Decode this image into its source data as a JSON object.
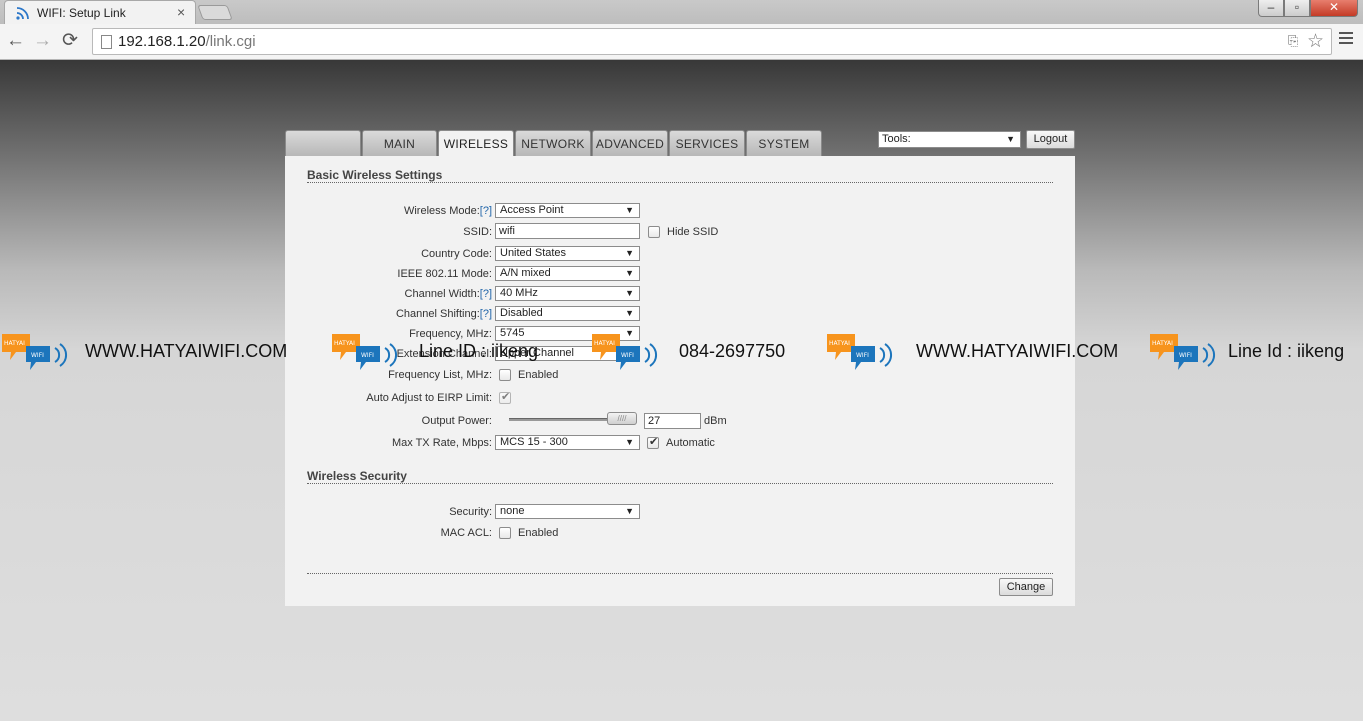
{
  "browser": {
    "tab_title": "WIFI: Setup Link",
    "tab_close": "×",
    "url_host": "192.168.1.20",
    "url_path": "/link.cgi",
    "back": "←",
    "forward": "→",
    "reload": "⟳",
    "star": "☆",
    "translate": "⎘",
    "win_min": "–",
    "win_max": "▫",
    "win_close": "✕"
  },
  "nav": {
    "logo_tab": "",
    "tabs": [
      "MAIN",
      "WIRELESS",
      "NETWORK",
      "ADVANCED",
      "SERVICES",
      "SYSTEM"
    ],
    "active_tab": "WIRELESS",
    "tools_select": "Tools:",
    "logout": "Logout"
  },
  "basic": {
    "title": "Basic Wireless Settings",
    "wireless_mode_label": "Wireless Mode:",
    "help": "[?]",
    "wireless_mode": "Access Point",
    "ssid_label": "SSID:",
    "ssid": "wifi",
    "hide_ssid": "Hide SSID",
    "country_code_label": "Country Code:",
    "country_code": "United States",
    "ieee_mode_label": "IEEE 802.11 Mode:",
    "ieee_mode": "A/N mixed",
    "channel_width_label": "Channel Width:",
    "channel_width": "40 MHz",
    "channel_shifting_label": "Channel Shifting:",
    "channel_shifting": "Disabled",
    "frequency_label": "Frequency, MHz:",
    "frequency": "5745",
    "extension_channel_label": "Extension Channel:",
    "extension_channel": "Upper Channel",
    "frequency_list_label": "Frequency List, MHz:",
    "frequency_list_enabled": "Enabled",
    "auto_eirp_label": "Auto Adjust to EIRP Limit:",
    "output_power_label": "Output Power:",
    "output_power": "27",
    "output_power_unit": "dBm",
    "slider_grip": "////",
    "max_tx_label": "Max TX Rate, Mbps:",
    "max_tx": "MCS 15 - 300",
    "automatic": "Automatic"
  },
  "security": {
    "title": "Wireless Security",
    "security_label": "Security:",
    "security": "none",
    "mac_acl_label": "MAC ACL:",
    "mac_acl_enabled": "Enabled"
  },
  "change_button": "Change",
  "dropdown_arrow": "▼",
  "watermark": {
    "site": "WWW.HATYAIWIFI.COM",
    "line_id_1": "Line ID : iikeng",
    "phone": "084-2697750",
    "line_id_2": "Line Id : iikeng",
    "logo_top": "HATYAI",
    "logo_bottom": "WIFI",
    "colors": {
      "orange": "#f7941d",
      "blue": "#1c75bc"
    }
  }
}
